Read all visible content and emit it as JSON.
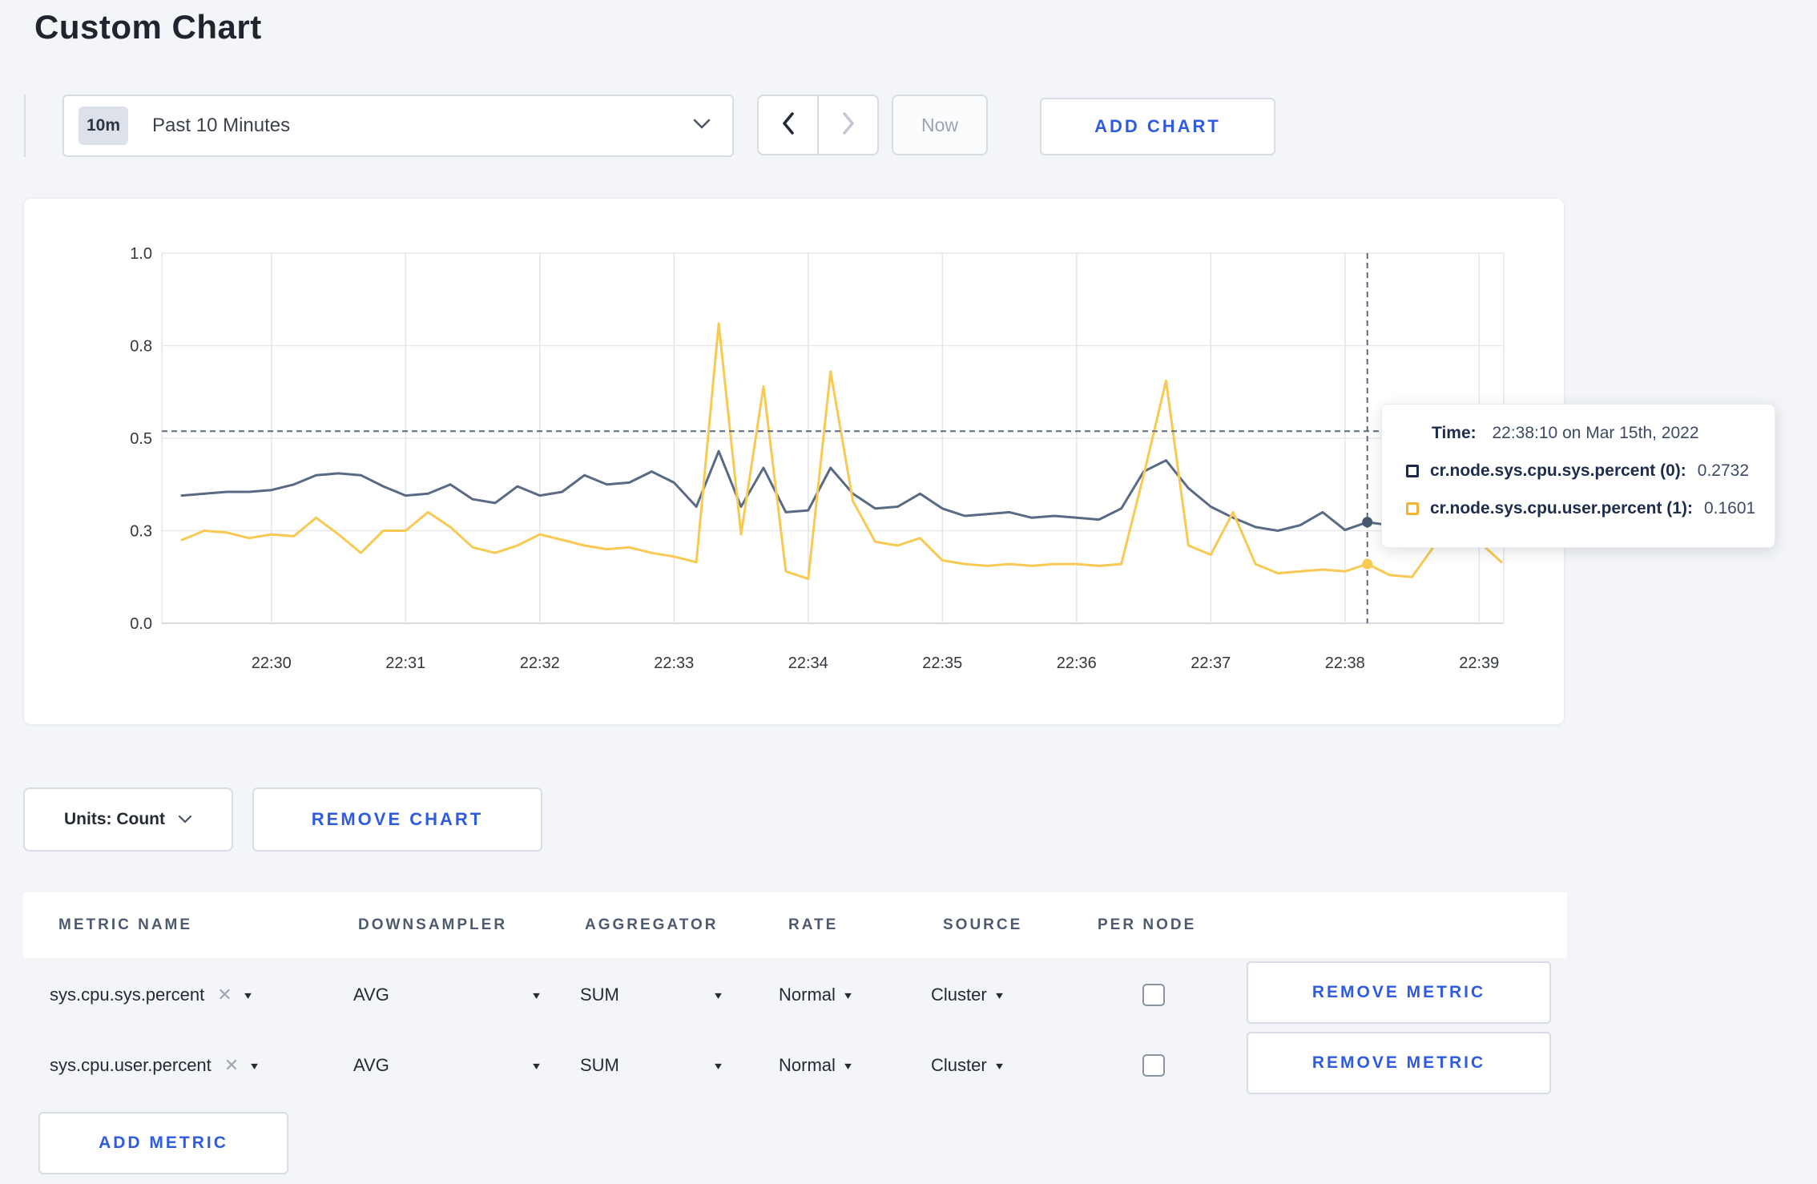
{
  "page": {
    "title": "Custom Chart"
  },
  "toolbar": {
    "time_range": {
      "badge": "10m",
      "label": "Past 10 Minutes"
    },
    "now_label": "Now",
    "add_chart_label": "ADD CHART"
  },
  "chart_card": {
    "units_label": "Units: Count",
    "remove_chart_label": "REMOVE CHART"
  },
  "tooltip": {
    "time_label": "Time:",
    "time_value": "22:38:10 on Mar 15th, 2022",
    "rows": [
      {
        "label": "cr.node.sys.cpu.sys.percent (0):",
        "value": "0.2732",
        "color": "#1c2b4a"
      },
      {
        "label": "cr.node.sys.cpu.user.percent (1):",
        "value": "0.1601",
        "color": "#f2b632"
      }
    ]
  },
  "metrics_table": {
    "headers": [
      "METRIC NAME",
      "DOWNSAMPLER",
      "AGGREGATOR",
      "RATE",
      "SOURCE",
      "PER NODE"
    ],
    "remove_metric_label": "REMOVE METRIC",
    "add_metric_label": "ADD METRIC",
    "rows": [
      {
        "metric": "sys.cpu.sys.percent",
        "downsampler": "AVG",
        "aggregator": "SUM",
        "rate": "Normal",
        "source": "Cluster",
        "per_node_checked": false
      },
      {
        "metric": "sys.cpu.user.percent",
        "downsampler": "AVG",
        "aggregator": "SUM",
        "rate": "Normal",
        "source": "Cluster",
        "per_node_checked": false
      }
    ]
  },
  "chart_data": {
    "type": "line",
    "title": "",
    "xlabel": "",
    "ylabel": "",
    "ylim": [
      0,
      1
    ],
    "grid": true,
    "legend_position": "none",
    "y_ticks": [
      {
        "v": 1.0,
        "label": "1.0"
      },
      {
        "v": 0.75,
        "label": "0.8"
      },
      {
        "v": 0.5,
        "label": "0.5"
      },
      {
        "v": 0.25,
        "label": "0.3"
      },
      {
        "v": 0.0,
        "label": "0.0"
      }
    ],
    "x_tick_labels": [
      "22:30",
      "22:31",
      "22:32",
      "22:33",
      "22:34",
      "22:35",
      "22:36",
      "22:37",
      "22:38",
      "22:39"
    ],
    "x_domain": [
      "22:29:11",
      "22:39:11"
    ],
    "x_times": [
      "22:29:20",
      "22:29:30",
      "22:29:40",
      "22:29:50",
      "22:30:00",
      "22:30:10",
      "22:30:20",
      "22:30:30",
      "22:30:40",
      "22:30:50",
      "22:31:00",
      "22:31:10",
      "22:31:20",
      "22:31:30",
      "22:31:40",
      "22:31:50",
      "22:32:00",
      "22:32:10",
      "22:32:20",
      "22:32:30",
      "22:32:40",
      "22:32:50",
      "22:33:00",
      "22:33:10",
      "22:33:20",
      "22:33:30",
      "22:33:40",
      "22:33:50",
      "22:34:00",
      "22:34:10",
      "22:34:20",
      "22:34:30",
      "22:34:40",
      "22:34:50",
      "22:35:00",
      "22:35:10",
      "22:35:20",
      "22:35:30",
      "22:35:40",
      "22:35:50",
      "22:36:00",
      "22:36:10",
      "22:36:20",
      "22:36:30",
      "22:36:40",
      "22:36:50",
      "22:37:00",
      "22:37:10",
      "22:37:20",
      "22:37:30",
      "22:37:40",
      "22:37:50",
      "22:38:00",
      "22:38:10",
      "22:38:20",
      "22:38:30",
      "22:38:40",
      "22:38:50",
      "22:39:00",
      "22:39:10"
    ],
    "series": [
      {
        "name": "cr.node.sys.cpu.sys.percent",
        "color": "#5a6a84",
        "values": [
          0.345,
          0.35,
          0.355,
          0.355,
          0.36,
          0.375,
          0.4,
          0.405,
          0.4,
          0.37,
          0.345,
          0.35,
          0.375,
          0.335,
          0.325,
          0.37,
          0.345,
          0.355,
          0.4,
          0.375,
          0.38,
          0.41,
          0.38,
          0.315,
          0.465,
          0.315,
          0.42,
          0.3,
          0.305,
          0.42,
          0.35,
          0.31,
          0.315,
          0.35,
          0.31,
          0.29,
          0.295,
          0.3,
          0.285,
          0.29,
          0.285,
          0.28,
          0.31,
          0.41,
          0.44,
          0.365,
          0.315,
          0.285,
          0.26,
          0.25,
          0.265,
          0.3,
          0.252,
          0.2732,
          0.265,
          0.275,
          0.27,
          0.27,
          0.272,
          0.275
        ]
      },
      {
        "name": "cr.node.sys.cpu.user.percent",
        "color": "#f8ca53",
        "values": [
          0.225,
          0.25,
          0.245,
          0.23,
          0.24,
          0.235,
          0.285,
          0.24,
          0.19,
          0.25,
          0.25,
          0.3,
          0.26,
          0.205,
          0.19,
          0.21,
          0.24,
          0.225,
          0.21,
          0.2,
          0.205,
          0.19,
          0.18,
          0.165,
          0.81,
          0.24,
          0.64,
          0.14,
          0.12,
          0.68,
          0.33,
          0.22,
          0.21,
          0.23,
          0.17,
          0.16,
          0.155,
          0.16,
          0.155,
          0.16,
          0.16,
          0.155,
          0.16,
          0.4,
          0.655,
          0.21,
          0.185,
          0.3,
          0.16,
          0.135,
          0.14,
          0.145,
          0.14,
          0.1601,
          0.13,
          0.125,
          0.21,
          0.265,
          0.22,
          0.165
        ]
      }
    ],
    "crosshair": {
      "time": "22:38:10",
      "h_line_value": 0.519,
      "points": [
        {
          "series": 0,
          "value": 0.2732
        },
        {
          "series": 1,
          "value": 0.1601
        }
      ]
    }
  }
}
